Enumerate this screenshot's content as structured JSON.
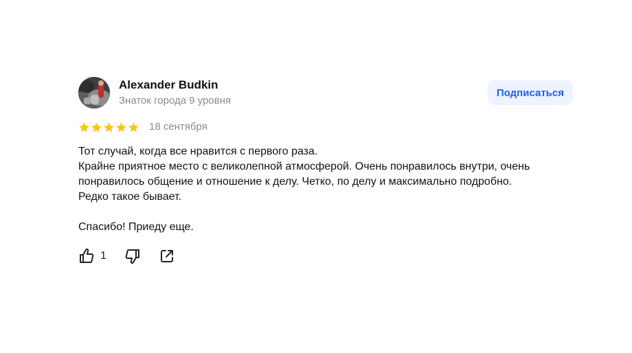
{
  "review": {
    "author": {
      "name": "Alexander Budkin",
      "level": "Знаток города 9 уровня"
    },
    "subscribe_label": "Подписаться",
    "rating": 5,
    "date": "18 сентября",
    "text": {
      "line1": "Тот случай, когда все нравится с первого раза.",
      "line2": "Крайне приятное место с великолепной атмосферой. Очень понравилось внутри, очень понравилось общение и отношение к делу. Четко, по делу и максимально подробно.",
      "line3": "Редко такое бывает.",
      "line4": "Спасибо! Приеду еще."
    },
    "likes": "1",
    "icons": {
      "like": "thumbs-up-icon",
      "dislike": "thumbs-down-icon",
      "share": "share-icon",
      "star": "star-icon"
    },
    "colors": {
      "accent": "#1d5ff2",
      "subscribe_bg": "#eef3ff",
      "star": "#fcc41f",
      "muted": "#8a8a8a"
    }
  }
}
